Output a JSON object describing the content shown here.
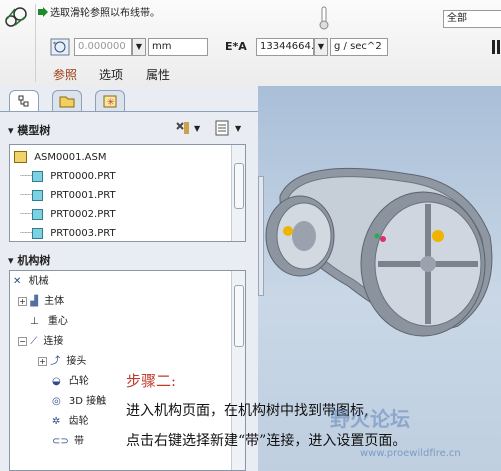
{
  "dashboard": {
    "prompt": "选取滑轮参照以布线带。",
    "diameter_value": "0.000000",
    "diameter_unit": "mm",
    "ea_label": "E*A",
    "ea_value": "13344664.",
    "ea_unit": "g / sec^2",
    "filter_value": "全部",
    "tabs": [
      "参照",
      "选项",
      "属性"
    ]
  },
  "model_tree": {
    "header": "模型树",
    "items": [
      "ASM0001.ASM",
      "PRT0000.PRT",
      "PRT0001.PRT",
      "PRT0002.PRT",
      "PRT0003.PRT"
    ]
  },
  "mechanism_tree": {
    "header": "机构树",
    "root": "机械",
    "items": [
      {
        "label": "主体"
      },
      {
        "label": "重心"
      },
      {
        "label": "连接"
      },
      {
        "label": "接头"
      },
      {
        "label": "凸轮"
      },
      {
        "label": "3D 接触"
      },
      {
        "label": "齿轮"
      },
      {
        "label": "带"
      }
    ]
  },
  "caption": {
    "title": "步骤二:",
    "line1": "进入机构页面，在机构树中找到带图标,",
    "line2": "点击右键选择新建“带”连接，进入设置页面。"
  },
  "watermark": {
    "text": "野火论坛",
    "url": "www.proewildfire.cn"
  },
  "colors": {
    "accent_red": "#c0392b",
    "tab_text": "#9a3a10",
    "belt": "#9ea7b3"
  }
}
